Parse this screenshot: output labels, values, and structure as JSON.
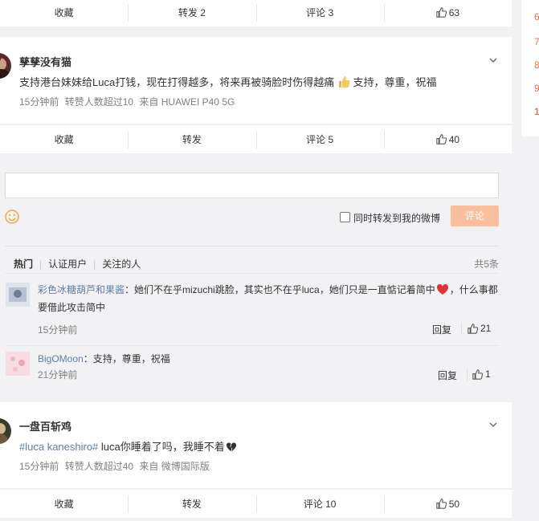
{
  "top_actions": {
    "fav": "收藏",
    "forward": "转发 2",
    "comment": "评论 3",
    "like": "63"
  },
  "post1": {
    "username": "孳孳没有猫",
    "text": "支持港台妹妹给Luca打钱，现在打得越多，将来再被骑脸时伤得越痛",
    "text_tail": "支持，尊重，祝福",
    "meta": [
      "15分钟前",
      "转赞人数超过10",
      "来自 HUAWEI P40 5G"
    ],
    "actions": {
      "fav": "收藏",
      "forward": "转发",
      "comment": "评论 5",
      "like": "40"
    }
  },
  "comment_box": {
    "placeholder": "",
    "also_forward": "同时转发到我的微博",
    "submit": "评论"
  },
  "comment_tabs": [
    "热门",
    "认证用户",
    "关注的人"
  ],
  "comment_count": "共5条",
  "comments": [
    {
      "user": "彩色冰糖葫芦和果酱",
      "text": "：她们不在乎mizuchi跳脸，其实也不在乎luca，她们只是一直惦记着简中",
      "text2": "，什么事都要借此攻击简中",
      "time": "15分钟前",
      "reply": "回复",
      "likes": "21"
    },
    {
      "user": "BigOMoon",
      "text": "：支持，尊重，祝福",
      "time": "21分钟前",
      "reply": "回复",
      "likes": "1"
    }
  ],
  "post2": {
    "username": "一盘百斩鸡",
    "hashtag": "#luca kaneshiro#",
    "text": " luca你睡着了吗，我睡不着",
    "meta": [
      "15分钟前",
      "转赞人数超过40",
      "来自 微博国际版"
    ],
    "actions": {
      "fav": "收藏",
      "forward": "转发",
      "comment": "评论 10",
      "like": "50"
    }
  },
  "right_numbers": [
    "6",
    "7",
    "8",
    "9",
    "1"
  ],
  "colors": {
    "accent": "#eb7350",
    "link": "#5d7ea8",
    "button_disabled": "#fbbf9e"
  }
}
